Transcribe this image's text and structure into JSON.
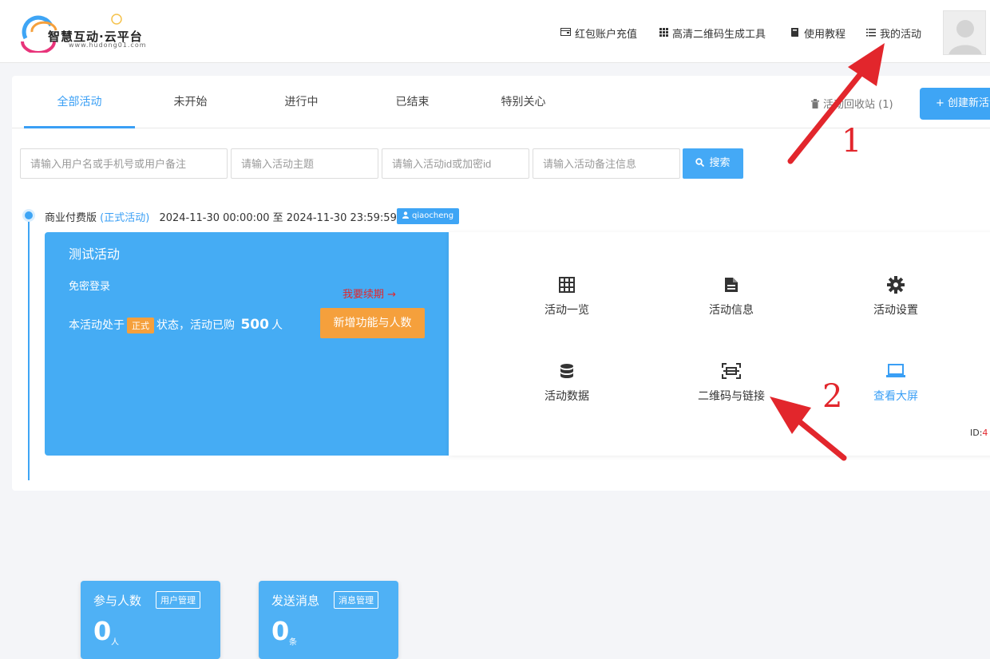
{
  "header": {
    "logo_text": "智慧互动·云平台",
    "logo_sub": "www.hudong01.com",
    "nav": [
      {
        "label": "红包账户充值",
        "icon": "wallet-icon"
      },
      {
        "label": "高清二维码生成工具",
        "icon": "grid-icon"
      },
      {
        "label": "使用教程",
        "icon": "book-icon"
      },
      {
        "label": "我的活动",
        "icon": "list-icon"
      }
    ]
  },
  "tabs": [
    "全部活动",
    "未开始",
    "进行中",
    "已结束",
    "特别关心"
  ],
  "recycle": "活动回收站 (1)",
  "create_button": "+ 创建新活动",
  "filters": {
    "user_placeholder": "请输入用户名或手机号或用户备注",
    "topic_placeholder": "请输入活动主题",
    "id_placeholder": "请输入活动id或加密id",
    "note_placeholder": "请输入活动备注信息",
    "search_label": "搜索"
  },
  "activity": {
    "edition": "商业付费版",
    "edition_tag": "(正式活动)",
    "time_range": "2024-11-30 00:00:00 至 2024-11-30 23:59:59",
    "user_tag": "qiaocheng",
    "title": "测试活动",
    "login_mode": "免密登录",
    "status_prefix": "本活动处于",
    "status_badge": "正式",
    "status_mid": "状态，活动已购",
    "purchased": "500",
    "purchased_unit": "人",
    "renew": "我要续期 →",
    "add_features": "新增功能与人数",
    "participants": {
      "label": "参与人数",
      "manage": "用户管理",
      "value": "0",
      "unit": "人"
    },
    "messages": {
      "label": "发送消息",
      "manage": "消息管理",
      "value": "0",
      "unit": "条"
    },
    "actions": [
      {
        "label": "活动一览",
        "icon": "table-icon"
      },
      {
        "label": "活动信息",
        "icon": "document-icon"
      },
      {
        "label": "活动设置",
        "icon": "gear-icon"
      },
      {
        "label": "活动数据",
        "icon": "database-icon"
      },
      {
        "label": "二维码与链接",
        "icon": "qrcode-scan-icon"
      },
      {
        "label": "查看大屏",
        "icon": "laptop-icon"
      }
    ],
    "id_label": "ID:",
    "id_value": "4"
  },
  "annotations": {
    "one": "1",
    "two": "2"
  },
  "colors": {
    "primary": "#3ea5f5",
    "orange": "#f5a03c",
    "red_annotation": "#e2262c"
  }
}
